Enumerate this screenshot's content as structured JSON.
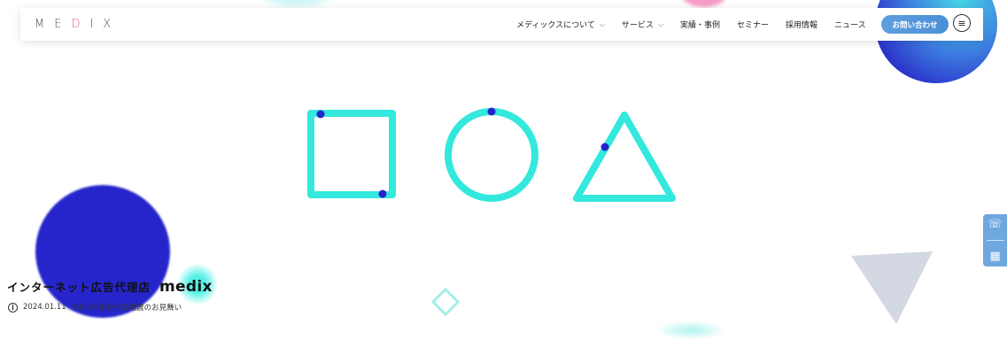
{
  "header": {
    "logo": {
      "before": "ME",
      "accent": "D",
      "after": "IX"
    },
    "nav": [
      {
        "label": "メディックスについて",
        "dropdown": true
      },
      {
        "label": "サービス",
        "dropdown": true
      },
      {
        "label": "実績・事例",
        "dropdown": false
      },
      {
        "label": "セミナー",
        "dropdown": false
      },
      {
        "label": "採用情報",
        "dropdown": false
      },
      {
        "label": "ニュース",
        "dropdown": false
      }
    ],
    "contact_label": "お問い合わせ",
    "menu_icon": "hamburger-icon"
  },
  "side_tabs": {
    "phone_icon": "phone-icon",
    "calendar_icon": "calendar-icon"
  },
  "hero": {
    "tagline": "インターネット広告代理店",
    "brand": "medix"
  },
  "news": {
    "date": "2024.01.11",
    "title": "令和6年能登半島地震のお見舞い"
  },
  "colors": {
    "accent_cyan": "#33e8dc",
    "accent_blue": "#2525cb",
    "logo_accent": "#e15aa3",
    "button_blue": "#5f9ede",
    "triangle_gray": "#d3d8e3"
  }
}
